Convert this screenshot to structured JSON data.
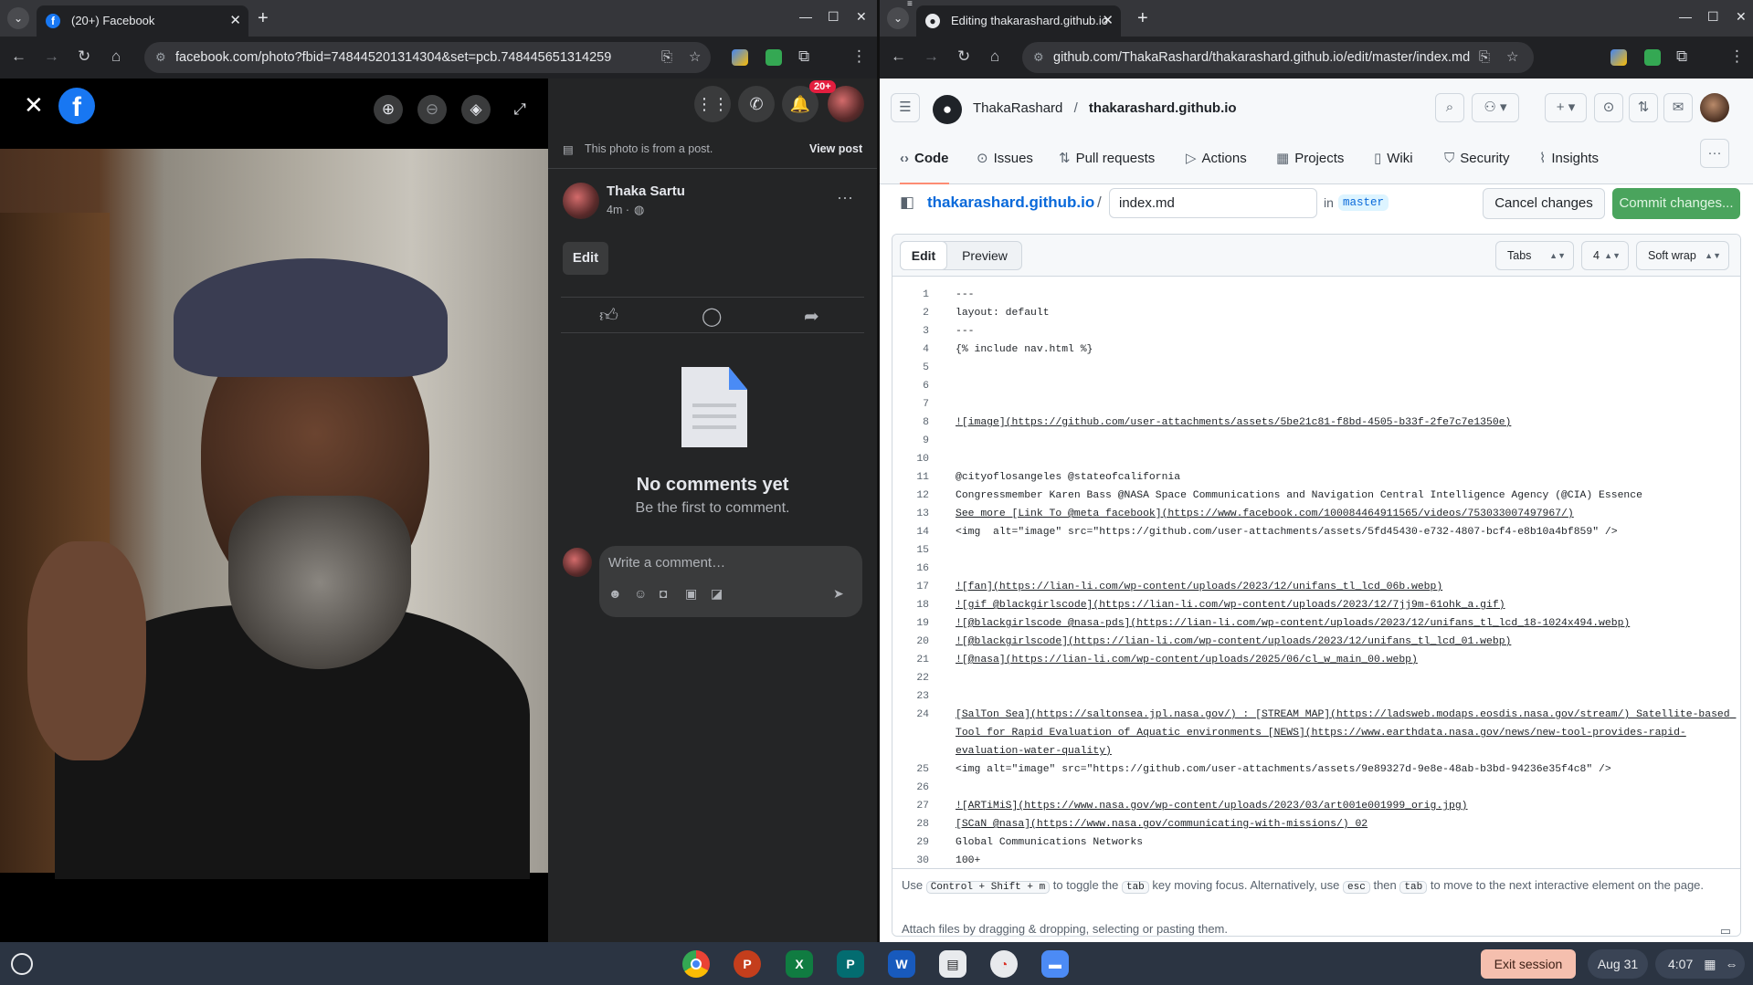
{
  "left_window": {
    "tab_title": "(20+) Facebook",
    "url": "facebook.com/photo?fbid=748445201314304&set=pcb.748445651314259",
    "notification_badge": "20+",
    "photo_from_post": "This photo is from a post.",
    "view_post": "View post",
    "author": "Thaka Sartu",
    "post_time": "4m ·",
    "edit_label": "Edit",
    "no_comments_title": "No comments yet",
    "no_comments_sub": "Be the first to comment.",
    "comment_placeholder": "Write a comment…"
  },
  "right_window": {
    "tab_title": "Editing thakarashard.github.io",
    "url": "github.com/ThakaRashard/thakarashard.github.io/edit/master/index.md",
    "owner": "ThakaRashard",
    "repo": "thakarashard.github.io",
    "nav": [
      "Code",
      "Issues",
      "Pull requests",
      "Actions",
      "Projects",
      "Wiki",
      "Security",
      "Insights"
    ],
    "breadcrumb_repo": "thakarashard.github.io",
    "filename": "index.md",
    "in_label": "in",
    "branch": "master",
    "cancel": "Cancel changes",
    "commit": "Commit changes...",
    "edit_tab": "Edit",
    "preview_tab": "Preview",
    "indent_mode": "Tabs",
    "indent_size": "4",
    "wrap_mode": "Soft wrap",
    "code_lines": [
      "---",
      "layout: default",
      "---",
      "{% include nav.html %}",
      "",
      "",
      "",
      "![image](https://github.com/user-attachments/assets/5be21c81-f8bd-4505-b33f-2fe7c7e1350e)",
      "",
      "",
      "@cityoflosangeles @stateofcalifornia",
      "Congressmember Karen Bass @NASA Space Communications and Navigation Central Intelligence Agency (@CIA) Essence",
      "See more [Link To @meta facebook](https://www.facebook.com/100084464911565/videos/753033007497967/)",
      "<img  alt=\"image\" src=\"https://github.com/user-attachments/assets/5fd45430-e732-4807-bcf4-e8b10a4bf859\" />",
      "",
      "",
      "![fan](https://lian-li.com/wp-content/uploads/2023/12/unifans_tl_lcd_06b.webp)",
      "![gif @blackgirlscode](https://lian-li.com/wp-content/uploads/2023/12/7jj9m-61ohk_a.gif)",
      "![@blackgirlscode @nasa-pds](https://lian-li.com/wp-content/uploads/2023/12/unifans_tl_lcd_18-1024x494.webp)",
      "![@blackgirlscode](https://lian-li.com/wp-content/uploads/2023/12/unifans_tl_lcd_01.webp)",
      "![@nasa](https://lian-li.com/wp-content/uploads/2025/06/cl_w_main_00.webp)",
      "",
      "",
      "[SalTon Sea](https://saltonsea.jpl.nasa.gov/) : [STREAM MAP](https://ladsweb.modaps.eosdis.nasa.gov/stream/) Satellite-based Tool for Rapid Evaluation of Aquatic environments [NEWS](https://www.earthdata.nasa.gov/news/new-tool-provides-rapid-evaluation-water-quality)",
      "<img alt=\"image\" src=\"https://github.com/user-attachments/assets/9e89327d-9e8e-48ab-b3bd-94236e35f4c8\" />",
      "",
      "![ARTiMiS](https://www.nasa.gov/wp-content/uploads/2023/03/art001e001999_orig.jpg)",
      "[SCaN @nasa](https://www.nasa.gov/communicating-with-missions/) 02",
      "Global Communications Networks",
      "100+"
    ],
    "footer_use": "Use",
    "footer_k1": "Control + Shift + m",
    "footer_mid1": "to toggle the",
    "footer_k2": "tab",
    "footer_mid2": "key moving focus. Alternatively, use",
    "footer_k3": "esc",
    "footer_then": "then",
    "footer_k4": "tab",
    "footer_end": "to move to the next interactive element on the page.",
    "attach": "Attach files by dragging & dropping, selecting or pasting them."
  },
  "shelf": {
    "exit": "Exit session",
    "date": "Aug 31",
    "time": "4:07"
  }
}
